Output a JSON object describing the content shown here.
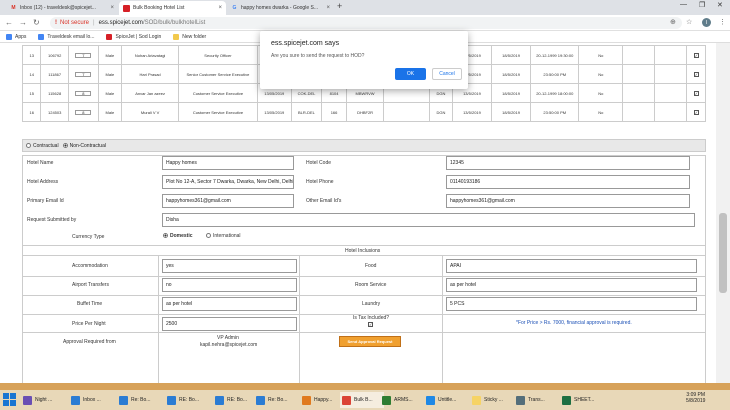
{
  "browser": {
    "tabs": [
      {
        "title": "Inbox (12) - traveldesk@spicejet...",
        "icon": "gmail-icon"
      },
      {
        "title": "Bulk Booking Hotel List",
        "icon": "spicejet-icon"
      },
      {
        "title": "happy homes dwarka - Google S...",
        "icon": "google-icon"
      }
    ],
    "warning_icon": "!",
    "not_secure": "Not secure",
    "url_host": "ess.spicejet.com",
    "url_path": "/SOD/bulk/bulkhotelList",
    "avatar_letter": "I"
  },
  "bookmarks": [
    {
      "label": "Apps"
    },
    {
      "label": "Traveldesk email lo..."
    },
    {
      "label": "SpiceJet | Sod Login"
    },
    {
      "label": "New folder"
    }
  ],
  "table_rows": [
    {
      "sno": "13",
      "emp": "106792",
      "select": "7",
      "gender": "Male",
      "name": "Nohan Ariavatagi",
      "designation": "Security Officer",
      "date": "",
      "route": "",
      "flight": "",
      "pnr": "",
      "blank": "",
      "code": "",
      "date2": "13/5/2019",
      "date3": "18/5/2019",
      "checkin": "20-12-1999 19:30:00",
      "tax": "No"
    },
    {
      "sno": "14",
      "emp": "111867",
      "select": "7",
      "gender": "Male",
      "name": "Hari Prasad",
      "designation": "Senior Customer Service Executive",
      "date": "",
      "route": "",
      "flight": "",
      "pnr": "",
      "blank": "",
      "code": "",
      "date2": "13/5/2019",
      "date3": "18/5/2019",
      "checkin": "23:50:00 PM",
      "tax": "No"
    },
    {
      "sno": "15",
      "emp": "115628",
      "select": "8",
      "gender": "Male",
      "name": "Anvar Jan azeez",
      "designation": "Customer Service Executive",
      "date": "13/05/2019",
      "route": "COK-DEL",
      "flight": "8104",
      "pnr": "MBWRVW",
      "blank": "",
      "code": "DGN",
      "date2": "13/5/2019",
      "date3": "18/5/2019",
      "checkin": "20-12-1999 18:00:00",
      "tax": "No"
    },
    {
      "sno": "16",
      "emp": "124503",
      "select": "8",
      "gender": "Male",
      "name": "Murali V V",
      "designation": "Customer Service Executive",
      "date": "13/05/2019",
      "route": "BLR-DEL",
      "flight": "166",
      "pnr": "DHBF2R",
      "blank": "",
      "code": "DGN",
      "date2": "13/5/2019",
      "date3": "18/5/2019",
      "checkin": "23:50:00 PM",
      "tax": "No"
    }
  ],
  "contract": {
    "option1": "Contractual",
    "option2": "Non-Contractual"
  },
  "hotel": {
    "name_label": "Hotel Name",
    "name_value": "Happy homes",
    "code_label": "Hotel Code",
    "code_value": "12345",
    "address_label": "Hotel Address",
    "address_value": "Plot No 12-A, Sector 7 Dwarka, Dwarka, New Delhi, Delhi 1",
    "phone_label": "Hotel Phone",
    "phone_value": "01140193186",
    "email_label": "Primary Email Id",
    "email_value": "happyhomes361@gmail.com",
    "other_email_label": "Other Email Id's",
    "other_email_value": "happyhomes361@gmail.com",
    "requested_label": "Request Submitted by",
    "requested_value": "Disha",
    "currency_label": "Currency Type",
    "currency_domestic": "Domestic",
    "currency_international": "International",
    "inclusions_title": "Hotel Inclusions",
    "accommodation_label": "Accommodation",
    "accommodation_value": "yes",
    "food_label": "Food",
    "food_value": "APAI",
    "airport_label": "Airport Transfers",
    "airport_value": "no",
    "room_service_label": "Room Service",
    "room_service_value": "as per hotel",
    "buffet_label": "Buffet Time",
    "buffet_value": "as per hotel",
    "laundry_label": "Laundry",
    "laundry_value": "5 PCS",
    "price_label": "Price Per Night",
    "price_value": "2500",
    "tax_label": "Is Tax Included?",
    "price_note": "*For Price > Rs. 7000, financial approval is required.",
    "approval_label": "Approval Required from",
    "approval_name": "VP Admin",
    "approval_email": "kapil.nehra@spicejet.com",
    "send_button": "Send Approval Request"
  },
  "dialog": {
    "title": "ess.spicejet.com says",
    "message": "Are you sure to send the request to HOD?",
    "ok": "OK",
    "cancel": "Cancel"
  },
  "taskbar": {
    "items": [
      {
        "label": "Night ...",
        "color": "#6a4fb3"
      },
      {
        "label": "Inbox ...",
        "color": "#2b7cd3"
      },
      {
        "label": "Re: Bo...",
        "color": "#2b7cd3"
      },
      {
        "label": "RE: Bo...",
        "color": "#2b7cd3"
      },
      {
        "label": "RE: Bo...",
        "color": "#2b7cd3"
      },
      {
        "label": "Re: Bo...",
        "color": "#2b7cd3"
      },
      {
        "label": "Happy...",
        "color": "#e07a1f"
      },
      {
        "label": "Bulk B...",
        "color": "#db4437"
      },
      {
        "label": "ARMS...",
        "color": "#2e7d32"
      },
      {
        "label": "Untitle...",
        "color": "#1e88e5"
      },
      {
        "label": "Sticky ...",
        "color": "#f6d365"
      },
      {
        "label": "Trans...",
        "color": "#546e7a"
      },
      {
        "label": "SHEET...",
        "color": "#1d6f42"
      }
    ],
    "time": "3:09 PM",
    "date": "5/8/2019"
  }
}
